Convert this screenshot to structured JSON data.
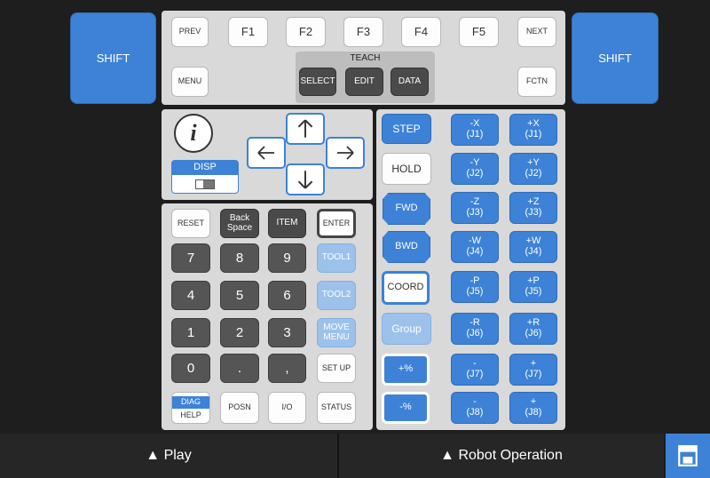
{
  "shift": {
    "left": "SHIFT",
    "right": "SHIFT"
  },
  "top": {
    "prev": "PREV",
    "f1": "F1",
    "f2": "F2",
    "f3": "F3",
    "f4": "F4",
    "f5": "F5",
    "next": "NEXT",
    "menu": "MENU",
    "teach": "TEACH",
    "select": "SELECT",
    "edit": "EDIT",
    "data": "DATA",
    "fctn": "FCTN"
  },
  "nav": {
    "info": "i",
    "disp": "DISP"
  },
  "left": {
    "reset": "RESET",
    "backspace": "Back\nSpace",
    "item": "ITEM",
    "enter": "ENTER",
    "n7": "7",
    "n8": "8",
    "n9": "9",
    "tool1": "TOOL1",
    "n4": "4",
    "n5": "5",
    "n6": "6",
    "tool2": "TOOL2",
    "n1": "1",
    "n2": "2",
    "n3": "3",
    "move_menu": "MOVE\nMENU",
    "n0": "0",
    "dot": ".",
    "comma": ",",
    "setup": "SET UP",
    "diag": "DIAG",
    "help": "HELP",
    "posn": "POSN",
    "io": "I/O",
    "status": "STATUS"
  },
  "mid": {
    "step": "STEP",
    "hold": "HOLD",
    "fwd": "FWD",
    "bwd": "BWD",
    "coord": "COORD",
    "group": "Group",
    "plus_pct": "+%",
    "minus_pct": "-%"
  },
  "jog": {
    "mx": "-X\n(J1)",
    "px": "+X\n(J1)",
    "my": "-Y\n(J2)",
    "py": "+Y\n(J2)",
    "mz": "-Z\n(J3)",
    "pz": "+Z\n(J3)",
    "mw": "-W\n(J4)",
    "pw": "+W\n(J4)",
    "mp": "-P\n(J5)",
    "pp": "+P\n(J5)",
    "mr": "-R\n(J6)",
    "pr": "+R\n(J6)",
    "m7": "-\n(J7)",
    "p7": "+\n(J7)",
    "m8": "-\n(J8)",
    "p8": "+\n(J8)"
  },
  "footer": {
    "play": "▲ Play",
    "robot": "▲ Robot Operation"
  },
  "icons": {
    "arrow_up": "arrow-up-icon",
    "arrow_down": "arrow-down-icon",
    "arrow_left": "arrow-left-icon",
    "arrow_right": "arrow-right-icon",
    "pendant": "pendant-icon"
  },
  "colors": {
    "blue": "#3d82d6",
    "light_blue": "#9cc2ec",
    "dark_key": "#4a4a4a",
    "panel": "#d9d9d9"
  }
}
